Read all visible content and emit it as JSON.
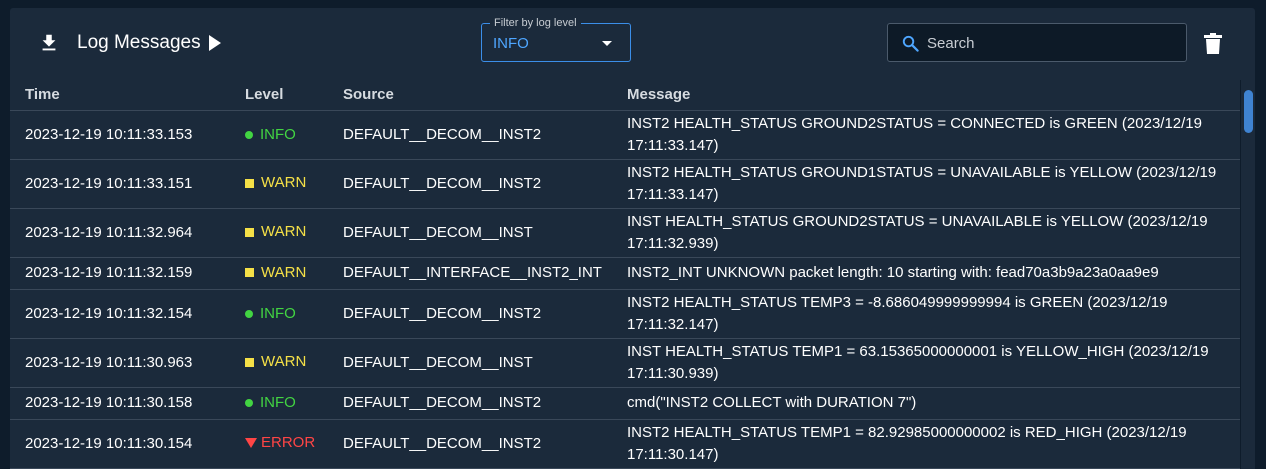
{
  "header": {
    "title": "Log Messages",
    "filter_label": "Filter by log level",
    "filter_value": "INFO",
    "search_placeholder": "Search"
  },
  "table": {
    "columns": [
      "Time",
      "Level",
      "Source",
      "Message"
    ],
    "rows": [
      {
        "time": "2023-12-19 10:11:33.153",
        "level": "INFO",
        "source": "DEFAULT__DECOM__INST2",
        "message": "INST2 HEALTH_STATUS GROUND2STATUS = CONNECTED is GREEN (2023/12/19 17:11:33.147)"
      },
      {
        "time": "2023-12-19 10:11:33.151",
        "level": "WARN",
        "source": "DEFAULT__DECOM__INST2",
        "message": "INST2 HEALTH_STATUS GROUND1STATUS = UNAVAILABLE is YELLOW (2023/12/19 17:11:33.147)"
      },
      {
        "time": "2023-12-19 10:11:32.964",
        "level": "WARN",
        "source": "DEFAULT__DECOM__INST",
        "message": "INST HEALTH_STATUS GROUND2STATUS = UNAVAILABLE is YELLOW (2023/12/19 17:11:32.939)"
      },
      {
        "time": "2023-12-19 10:11:32.159",
        "level": "WARN",
        "source": "DEFAULT__INTERFACE__INST2_INT",
        "message": "INST2_INT UNKNOWN packet length: 10 starting with: fead70a3b9a23a0aa9e9"
      },
      {
        "time": "2023-12-19 10:11:32.154",
        "level": "INFO",
        "source": "DEFAULT__DECOM__INST2",
        "message": "INST2 HEALTH_STATUS TEMP3 = -8.686049999999994 is GREEN (2023/12/19 17:11:32.147)"
      },
      {
        "time": "2023-12-19 10:11:30.963",
        "level": "WARN",
        "source": "DEFAULT__DECOM__INST",
        "message": "INST HEALTH_STATUS TEMP1 = 63.15365000000001 is YELLOW_HIGH (2023/12/19 17:11:30.939)"
      },
      {
        "time": "2023-12-19 10:11:30.158",
        "level": "INFO",
        "source": "DEFAULT__DECOM__INST2",
        "message": "cmd(\"INST2 COLLECT with DURATION 7\")"
      },
      {
        "time": "2023-12-19 10:11:30.154",
        "level": "ERROR",
        "source": "DEFAULT__DECOM__INST2",
        "message": "INST2 HEALTH_STATUS TEMP1 = 82.92985000000002 is RED_HIGH (2023/12/19 17:11:30.147)"
      }
    ]
  },
  "colors": {
    "info": "#42d442",
    "warn": "#f5e047",
    "error": "#ff4545",
    "accent": "#3b8ee8"
  }
}
